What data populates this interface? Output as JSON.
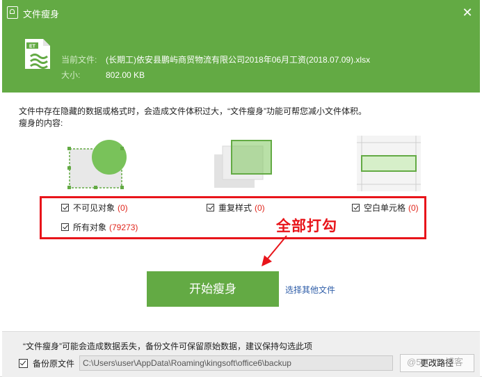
{
  "window": {
    "title": "文件瘦身"
  },
  "file": {
    "icon_label": "ET",
    "name_label": "当前文件:",
    "name_value": "(长期工)依安县鹏屿商贸物流有限公司2018年06月工资(2018.07.09).xlsx",
    "size_label": "大小:",
    "size_value": "802.00 KB"
  },
  "description": {
    "line1": "文件中存在隐藏的数据或格式时，会造成文件体积过大，“文件瘦身”功能可帮您减小文件体积。",
    "line2": "瘦身的内容:"
  },
  "options": [
    {
      "label": "不可见对象",
      "count": "(0)",
      "checked": true
    },
    {
      "label": "重复样式",
      "count": "(0)",
      "checked": true
    },
    {
      "label": "空白单元格",
      "count": "(0)",
      "checked": true
    },
    {
      "label": "所有对象",
      "count": "(79273)",
      "checked": true
    }
  ],
  "annotation": {
    "text": "全部打勾",
    "color": "#e8141a"
  },
  "actions": {
    "start_label": "开始瘦身",
    "other_file_link": "选择其他文件"
  },
  "footer": {
    "warning": "“文件瘦身”可能会造成数据丢失，备份文件可保留原始数据，建议保持勾选此项",
    "backup_label": "备份原文件",
    "backup_checked": true,
    "backup_path": "C:\\Users\\user\\AppData\\Roaming\\kingsoft\\office6\\backup",
    "change_path_label": "更改路径"
  },
  "watermark": "@51CTO博客",
  "colors": {
    "brand_green": "#63aa44",
    "highlight_red": "#e8141a",
    "link_blue": "#2e5da8"
  }
}
